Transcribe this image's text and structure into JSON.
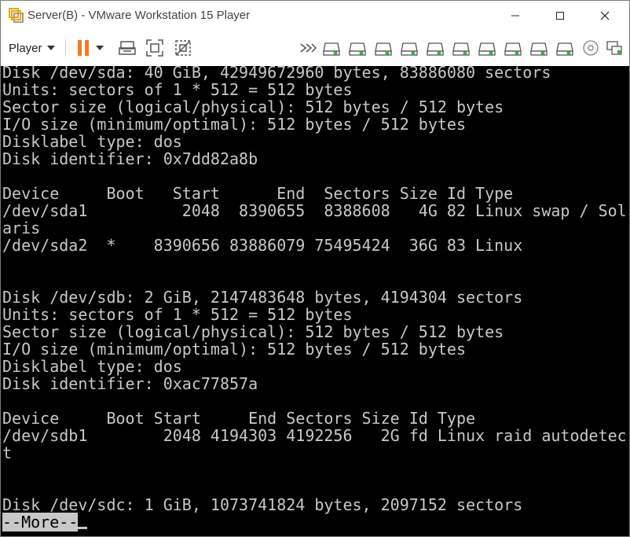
{
  "window": {
    "title": "Server(B) - VMware Workstation 15 Player",
    "controls": [
      "minimize",
      "maximize",
      "close"
    ]
  },
  "toolbar": {
    "player_label": "Player",
    "left_icons": [
      "pause-icon",
      "dropdown-arrow-icon",
      "send-ctrl-alt-del-icon",
      "fit-guest-icon",
      "unity-icon"
    ],
    "right_icons": [
      "more-devices-icon",
      "hard-disk-icon",
      "hard-disk-icon",
      "hard-disk-icon",
      "hard-disk-icon",
      "hard-disk-icon",
      "hard-disk-icon",
      "hard-disk-icon",
      "hard-disk-icon",
      "hard-disk-icon",
      "cd-dvd-icon",
      "network-adapter-icon"
    ]
  },
  "console": {
    "lines": [
      "Disk /dev/sda: 40 GiB, 42949672960 bytes, 83886080 sectors",
      "Units: sectors of 1 * 512 = 512 bytes",
      "Sector size (logical/physical): 512 bytes / 512 bytes",
      "I/O size (minimum/optimal): 512 bytes / 512 bytes",
      "Disklabel type: dos",
      "Disk identifier: 0x7dd82a8b",
      "",
      "Device     Boot   Start      End  Sectors Size Id Type",
      "/dev/sda1          2048  8390655  8388608   4G 82 Linux swap / Sol",
      "aris",
      "/dev/sda2  *    8390656 83886079 75495424  36G 83 Linux",
      "",
      "",
      "Disk /dev/sdb: 2 GiB, 2147483648 bytes, 4194304 sectors",
      "Units: sectors of 1 * 512 = 512 bytes",
      "Sector size (logical/physical): 512 bytes / 512 bytes",
      "I/O size (minimum/optimal): 512 bytes / 512 bytes",
      "Disklabel type: dos",
      "Disk identifier: 0xac77857a",
      "",
      "Device     Boot Start     End Sectors Size Id Type",
      "/dev/sdb1        2048 4194303 4192256   2G fd Linux raid autodetec",
      "t",
      "",
      "",
      "Disk /dev/sdc: 1 GiB, 1073741824 bytes, 2097152 sectors"
    ],
    "more_prompt": "--More--"
  }
}
